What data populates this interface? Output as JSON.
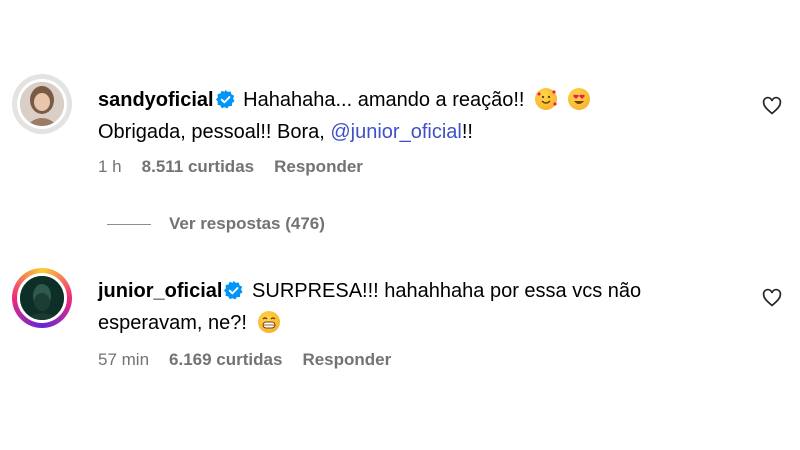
{
  "comments": [
    {
      "username": "sandyoficial",
      "text_line1": "Hahahaha... amando a reação!!",
      "text_line2_prefix": "Obrigada, pessoal!! Bora, ",
      "mention": "@junior_oficial",
      "text_line2_suffix": "!!",
      "emojis": [
        "smiling-face-with-hearts-emoji",
        "heart-eyes-emoji"
      ],
      "time": "1 h",
      "likes": "8.511 curtidas",
      "reply_label": "Responder"
    },
    {
      "username": "junior_oficial",
      "text_line1": "SURPRESA!!! hahahhaha por essa vcs não",
      "text_line2": "esperavam, ne?!",
      "emojis": [
        "grinning-face-emoji"
      ],
      "time": "57 min",
      "likes": "6.169 curtidas",
      "reply_label": "Responder"
    }
  ],
  "view_replies": "Ver respostas (476)",
  "colors": {
    "mention": "#3f51c8",
    "verified": "#0095f6",
    "meta": "#737373"
  }
}
